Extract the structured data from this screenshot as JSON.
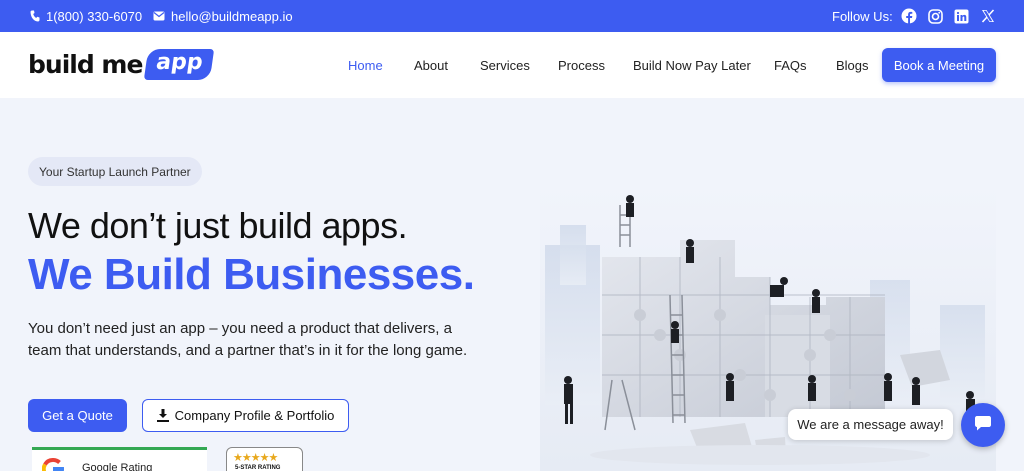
{
  "topbar": {
    "phone": "1(800) 330-6070",
    "email": "hello@buildmeapp.io",
    "follow_label": "Follow Us:",
    "social": [
      "facebook-icon",
      "instagram-icon",
      "linkedin-icon",
      "x-icon"
    ],
    "bg_color": "#3d5cf1"
  },
  "header": {
    "logo_text": "build me",
    "logo_pill": "app",
    "nav": [
      "Home",
      "About",
      "Services",
      "Process",
      "Build Now Pay Later",
      "FAQs",
      "Blogs"
    ],
    "active_nav": "Home",
    "cta": "Book a Meeting"
  },
  "hero": {
    "tag": "Your Startup Launch Partner",
    "headline_1": "We don’t just build apps.",
    "headline_2": "We Build Businesses.",
    "paragraph": "You don’t need just an app – you need a product that delivers, a team that understands, and a partner that’s in it for the long game.",
    "primary_button": "Get a Quote",
    "secondary_button": "Company Profile & Portfolio",
    "google_label": "Google Rating",
    "star_label": "5-STAR RATING",
    "stars": "★★★★★"
  },
  "chat": {
    "message": "We are a message away!"
  },
  "colors": {
    "accent": "#3d5cf1",
    "background": "#f1f4fb"
  }
}
